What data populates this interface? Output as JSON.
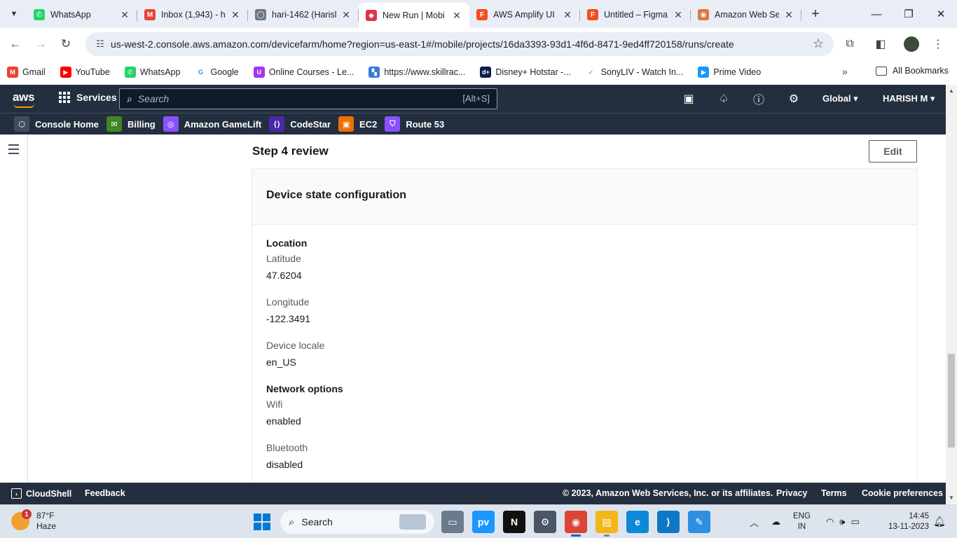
{
  "browser": {
    "tabs": [
      {
        "title": "WhatsApp",
        "icon": "whatsapp-icon",
        "color": "#25d366",
        "glyph": "✆",
        "active": false
      },
      {
        "title": "Inbox (1,943) - h",
        "icon": "gmail-icon",
        "color": "#ea4335",
        "glyph": "M",
        "active": false
      },
      {
        "title": "hari-1462 (Harisl",
        "icon": "github-icon",
        "color": "#6e7681",
        "glyph": "◯",
        "active": false
      },
      {
        "title": "New Run | Mobi",
        "icon": "aws-device-farm-icon",
        "color": "#dd344c",
        "glyph": "◆",
        "active": true
      },
      {
        "title": "AWS Amplify UI",
        "icon": "figma-icon",
        "color": "#f24e1e",
        "glyph": "F",
        "active": false
      },
      {
        "title": "Untitled – Figma",
        "icon": "figma-icon",
        "color": "#f24e1e",
        "glyph": "F",
        "active": false
      },
      {
        "title": "Amazon Web Se",
        "icon": "aws-icon",
        "color": "#e07a3f",
        "glyph": "◉",
        "active": false
      }
    ],
    "url": "us-west-2.console.aws.amazon.com/devicefarm/home?region=us-east-1#/mobile/projects/16da3393-93d1-4f6d-8471-9ed4ff720158/runs/create",
    "bookmarks": [
      {
        "label": "Gmail",
        "icon": "gmail-icon",
        "color": "#ea4335",
        "glyph": "M"
      },
      {
        "label": "YouTube",
        "icon": "youtube-icon",
        "color": "#ff0000",
        "glyph": "▶"
      },
      {
        "label": "WhatsApp",
        "icon": "whatsapp-icon",
        "color": "#25d366",
        "glyph": "✆"
      },
      {
        "label": "Google",
        "icon": "google-icon",
        "color": "#ffffff",
        "glyph": "G"
      },
      {
        "label": "Online Courses - Le...",
        "icon": "udemy-icon",
        "color": "#a435f0",
        "glyph": "U"
      },
      {
        "label": "https://www.skillrac...",
        "icon": "skillrack-icon",
        "color": "#3c78d8",
        "glyph": "▚"
      },
      {
        "label": "Disney+ Hotstar -...",
        "icon": "hotstar-icon",
        "color": "#0f1c4a",
        "glyph": "d+"
      },
      {
        "label": "SonyLIV - Watch In...",
        "icon": "sonyliv-icon",
        "color": "#ffffff",
        "glyph": "✓"
      },
      {
        "label": "Prime Video",
        "icon": "prime-video-icon",
        "color": "#1a98ff",
        "glyph": "▶"
      }
    ],
    "all_bookmarks": "All Bookmarks"
  },
  "aws": {
    "logo": "aws",
    "services": "Services",
    "search_placeholder": "Search",
    "search_shortcut": "[Alt+S]",
    "region": "Global",
    "user": "HARISH M",
    "favorites": [
      {
        "label": "Console Home",
        "icon": "console-home-icon",
        "color": "#414d5c",
        "glyph": "⬡"
      },
      {
        "label": "Billing",
        "icon": "billing-icon",
        "color": "#3f8624",
        "glyph": "✉"
      },
      {
        "label": "Amazon GameLift",
        "icon": "gamelift-icon",
        "color": "#8c4fff",
        "glyph": "◎"
      },
      {
        "label": "CodeStar",
        "icon": "codestar-icon",
        "color": "#4d27aa",
        "glyph": "⟨⟩"
      },
      {
        "label": "EC2",
        "icon": "ec2-icon",
        "color": "#ed7100",
        "glyph": "▣"
      },
      {
        "label": "Route 53",
        "icon": "route53-icon",
        "color": "#8c4fff",
        "glyph": "⛉"
      }
    ]
  },
  "page": {
    "step_title": "Step 4 review",
    "edit_label": "Edit",
    "panel_title": "Device state configuration",
    "sections": [
      {
        "title": "Location",
        "fields": [
          {
            "label": "Latitude",
            "value": "47.6204"
          },
          {
            "label": "Longitude",
            "value": "-122.3491"
          },
          {
            "label": "Device locale",
            "value": "en_US"
          }
        ]
      },
      {
        "title": "Network options",
        "fields": [
          {
            "label": "Wifi",
            "value": "enabled"
          },
          {
            "label": "Bluetooth",
            "value": "disabled"
          }
        ]
      }
    ]
  },
  "footer": {
    "cloudshell": "CloudShell",
    "feedback": "Feedback",
    "copyright": "© 2023, Amazon Web Services, Inc. or its affiliates.",
    "privacy": "Privacy",
    "terms": "Terms",
    "cookies": "Cookie preferences"
  },
  "taskbar": {
    "temperature": "87°F",
    "weather": "Haze",
    "weather_badge": "1",
    "search": "Search",
    "lang_line1": "ENG",
    "lang_line2": "IN",
    "time": "14:45",
    "date": "13-11-2023",
    "apps": [
      {
        "name": "task-view-icon",
        "color": "#6b7a8c",
        "glyph": "▭",
        "state": ""
      },
      {
        "name": "prime-video-icon",
        "color": "#1a98ff",
        "glyph": "pv",
        "state": ""
      },
      {
        "name": "netflix-icon",
        "color": "#111111",
        "glyph": "N",
        "state": ""
      },
      {
        "name": "settings-icon",
        "color": "#4a5565",
        "glyph": "⚙",
        "state": ""
      },
      {
        "name": "chrome-icon",
        "color": "#db4437",
        "glyph": "◉",
        "state": "active"
      },
      {
        "name": "file-explorer-icon",
        "color": "#f2b619",
        "glyph": "▤",
        "state": "running"
      },
      {
        "name": "edge-icon",
        "color": "#0c8ad8",
        "glyph": "e",
        "state": ""
      },
      {
        "name": "vscode-icon",
        "color": "#0e78c4",
        "glyph": "⟩",
        "state": ""
      },
      {
        "name": "paint-icon",
        "color": "#2f8ee0",
        "glyph": "✎",
        "state": ""
      }
    ]
  }
}
